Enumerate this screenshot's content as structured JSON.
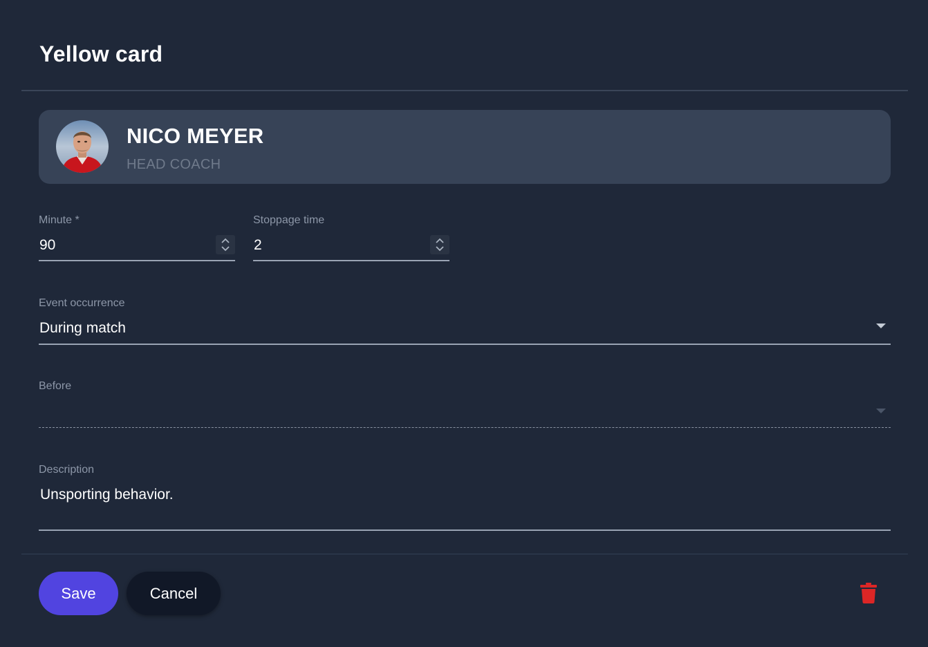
{
  "dialog": {
    "title": "Yellow card"
  },
  "person": {
    "name": "NICO MEYER",
    "role": "HEAD COACH"
  },
  "fields": {
    "minute": {
      "label": "Minute *",
      "value": "90"
    },
    "stoppage": {
      "label": "Stoppage time",
      "value": "2"
    },
    "occurrence": {
      "label": "Event occurrence",
      "value": "During match"
    },
    "before": {
      "label": "Before",
      "value": ""
    },
    "description": {
      "label": "Description",
      "value": "Unsporting behavior."
    }
  },
  "actions": {
    "save_label": "Save",
    "cancel_label": "Cancel",
    "delete_icon": "trash-icon"
  },
  "colors": {
    "background": "#1f2839",
    "card": "#374357",
    "primary": "#5144e0",
    "danger": "#dc2626"
  }
}
